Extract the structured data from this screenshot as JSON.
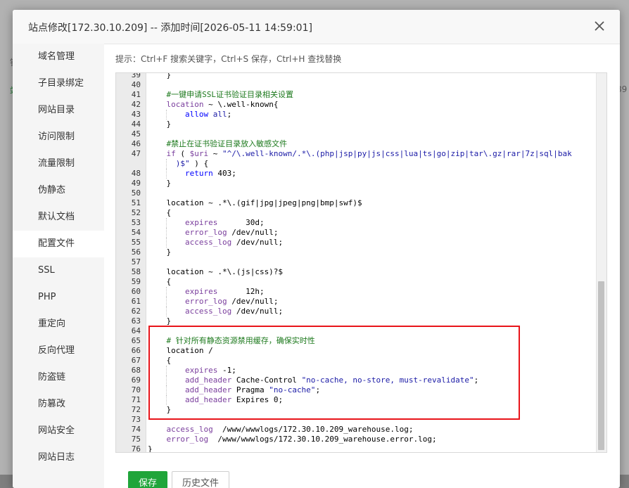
{
  "background": {
    "fragments": [
      "钱",
      "站",
      "89"
    ]
  },
  "dialog": {
    "title": "站点修改[172.30.10.209] -- 添加时间[2026-05-11 14:59:01]",
    "close_icon": "close-icon"
  },
  "sidebar": {
    "items": [
      {
        "label": "域名管理",
        "active": false
      },
      {
        "label": "子目录绑定",
        "active": false
      },
      {
        "label": "网站目录",
        "active": false
      },
      {
        "label": "访问限制",
        "active": false
      },
      {
        "label": "流量限制",
        "active": false
      },
      {
        "label": "伪静态",
        "active": false
      },
      {
        "label": "默认文档",
        "active": false
      },
      {
        "label": "配置文件",
        "active": true
      },
      {
        "label": "SSL",
        "active": false
      },
      {
        "label": "PHP",
        "active": false
      },
      {
        "label": "重定向",
        "active": false
      },
      {
        "label": "反向代理",
        "active": false
      },
      {
        "label": "防盗链",
        "active": false
      },
      {
        "label": "防篡改",
        "active": false
      },
      {
        "label": "网站安全",
        "active": false
      },
      {
        "label": "网站日志",
        "active": false
      }
    ]
  },
  "hint": "提示：Ctrl+F 搜索关键字，Ctrl+S 保存，Ctrl+H 查找替换",
  "editor": {
    "lines": [
      {
        "n": "39",
        "parts": [
          [
            "n",
            "    }"
          ]
        ]
      },
      {
        "n": "40",
        "parts": []
      },
      {
        "n": "41",
        "parts": [
          [
            "n",
            "    "
          ],
          [
            "c",
            "#一键申请SSL证书验证目录相关设置"
          ]
        ]
      },
      {
        "n": "42",
        "parts": [
          [
            "n",
            "    "
          ],
          [
            "k",
            "location"
          ],
          [
            "n",
            " ~ \\.well-known{"
          ]
        ]
      },
      {
        "n": "43",
        "parts": [
          [
            "n",
            "        "
          ],
          [
            "v",
            "allow"
          ],
          [
            "n",
            " "
          ],
          [
            "s",
            "all"
          ],
          [
            "n",
            ";"
          ]
        ]
      },
      {
        "n": "44",
        "parts": [
          [
            "n",
            "    }"
          ]
        ]
      },
      {
        "n": "45",
        "parts": []
      },
      {
        "n": "46",
        "parts": [
          [
            "n",
            "    "
          ],
          [
            "c",
            "#禁止在证书验证目录放入敏感文件"
          ]
        ]
      },
      {
        "n": "47",
        "parts": [
          [
            "k",
            "    if"
          ],
          [
            "n",
            " ( "
          ],
          [
            "k",
            "$uri"
          ],
          [
            "n",
            " ~ "
          ],
          [
            "s",
            "\"^/\\.well-known/.*\\.(php|jsp|py|js|css|lua|ts|go|zip|tar\\.gz|rar|7z|sql|bak"
          ]
        ]
      },
      {
        "n": "",
        "parts": [
          [
            "s",
            "      )$\""
          ],
          [
            "n",
            " ) {"
          ]
        ]
      },
      {
        "n": "48",
        "parts": [
          [
            "n",
            "        "
          ],
          [
            "v",
            "return"
          ],
          [
            "n",
            " 403;"
          ]
        ]
      },
      {
        "n": "49",
        "parts": [
          [
            "n",
            "    }"
          ]
        ]
      },
      {
        "n": "50",
        "parts": []
      },
      {
        "n": "51",
        "parts": [
          [
            "n",
            "    location ~ .*\\.(gif|jpg|jpeg|png|bmp|swf)$"
          ]
        ]
      },
      {
        "n": "52",
        "parts": [
          [
            "n",
            "    {"
          ]
        ]
      },
      {
        "n": "53",
        "parts": [
          [
            "n",
            "        "
          ],
          [
            "k",
            "expires"
          ],
          [
            "n",
            "      30d;"
          ]
        ]
      },
      {
        "n": "54",
        "parts": [
          [
            "n",
            "        "
          ],
          [
            "k",
            "error_log"
          ],
          [
            "n",
            " /dev/null;"
          ]
        ]
      },
      {
        "n": "55",
        "parts": [
          [
            "n",
            "        "
          ],
          [
            "k",
            "access_log"
          ],
          [
            "n",
            " /dev/null;"
          ]
        ]
      },
      {
        "n": "56",
        "parts": [
          [
            "n",
            "    }"
          ]
        ]
      },
      {
        "n": "57",
        "parts": []
      },
      {
        "n": "58",
        "parts": [
          [
            "n",
            "    location ~ .*\\.(js|css)?$"
          ]
        ]
      },
      {
        "n": "59",
        "parts": [
          [
            "n",
            "    {"
          ]
        ]
      },
      {
        "n": "60",
        "parts": [
          [
            "n",
            "        "
          ],
          [
            "k",
            "expires"
          ],
          [
            "n",
            "      12h;"
          ]
        ]
      },
      {
        "n": "61",
        "parts": [
          [
            "n",
            "        "
          ],
          [
            "k",
            "error_log"
          ],
          [
            "n",
            " /dev/null;"
          ]
        ]
      },
      {
        "n": "62",
        "parts": [
          [
            "n",
            "        "
          ],
          [
            "k",
            "access_log"
          ],
          [
            "n",
            " /dev/null;"
          ]
        ]
      },
      {
        "n": "63",
        "parts": [
          [
            "n",
            "    }"
          ]
        ]
      },
      {
        "n": "64",
        "parts": []
      },
      {
        "n": "65",
        "parts": [
          [
            "n",
            "    "
          ],
          [
            "c",
            "# 针对所有静态资源禁用缓存，确保实时性"
          ]
        ]
      },
      {
        "n": "66",
        "parts": [
          [
            "n",
            "    location /"
          ]
        ]
      },
      {
        "n": "67",
        "parts": [
          [
            "n",
            "    {"
          ]
        ]
      },
      {
        "n": "68",
        "parts": [
          [
            "n",
            "        "
          ],
          [
            "k",
            "expires"
          ],
          [
            "n",
            " -1;"
          ]
        ]
      },
      {
        "n": "69",
        "parts": [
          [
            "n",
            "        "
          ],
          [
            "k",
            "add_header"
          ],
          [
            "n",
            " Cache-Control "
          ],
          [
            "s",
            "\"no-cache, no-store, must-revalidate\""
          ],
          [
            "n",
            ";"
          ]
        ]
      },
      {
        "n": "70",
        "parts": [
          [
            "n",
            "        "
          ],
          [
            "k",
            "add_header"
          ],
          [
            "n",
            " Pragma "
          ],
          [
            "s",
            "\"no-cache\""
          ],
          [
            "n",
            ";"
          ]
        ]
      },
      {
        "n": "71",
        "parts": [
          [
            "n",
            "        "
          ],
          [
            "k",
            "add_header"
          ],
          [
            "n",
            " Expires 0;"
          ]
        ]
      },
      {
        "n": "72",
        "parts": [
          [
            "n",
            "    }"
          ]
        ]
      },
      {
        "n": "73",
        "parts": []
      },
      {
        "n": "74",
        "parts": [
          [
            "n",
            "    "
          ],
          [
            "k",
            "access_log"
          ],
          [
            "n",
            "  /www/wwwlogs/172.30.10.209_warehouse.log;"
          ]
        ]
      },
      {
        "n": "75",
        "parts": [
          [
            "n",
            "    "
          ],
          [
            "k",
            "error_log"
          ],
          [
            "n",
            "  /www/wwwlogs/172.30.10.209_warehouse.error.log;"
          ]
        ]
      },
      {
        "n": "76",
        "parts": [
          [
            "n",
            "}"
          ]
        ]
      }
    ],
    "colors": {
      "keyword": "#7a3e9d",
      "variable": "#0000ff",
      "comment": "#1e7a1e",
      "string": "#1a1aa6",
      "highlight_border": "#e8141a"
    }
  },
  "buttons": {
    "save_label": "保存",
    "history_label": "历史文件"
  },
  "accent": "#20a53a"
}
